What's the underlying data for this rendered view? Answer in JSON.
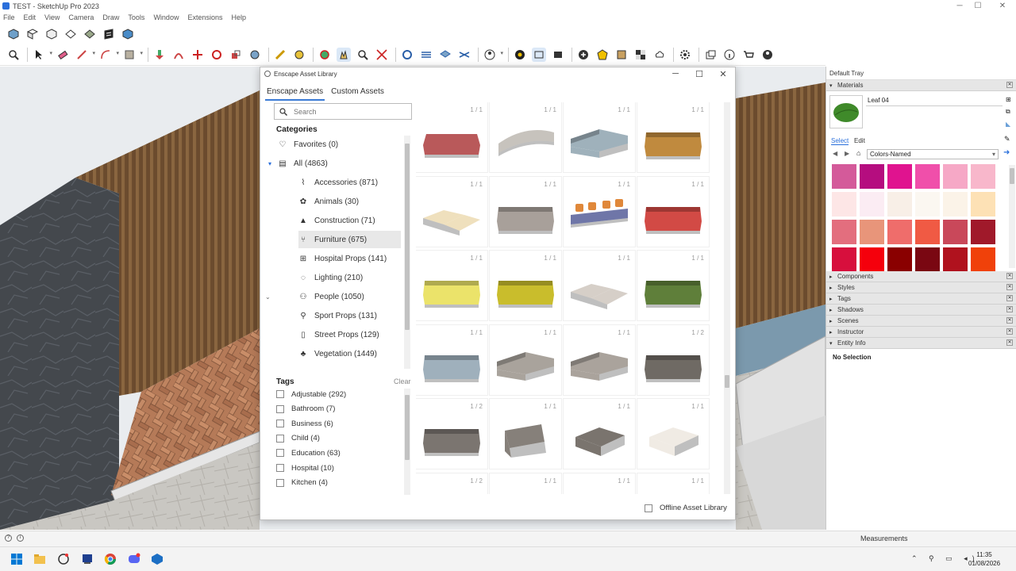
{
  "window": {
    "title": "TEST - SketchUp Pro 2023"
  },
  "menu": [
    "File",
    "Edit",
    "View",
    "Camera",
    "Draw",
    "Tools",
    "Window",
    "Extensions",
    "Help"
  ],
  "dialog": {
    "title": "Enscape Asset Library",
    "tabs": [
      "Enscape Assets",
      "Custom Assets"
    ],
    "search_placeholder": "Search",
    "categories_heading": "Categories",
    "categories": [
      {
        "label": "Favorites (0)",
        "icon": "heart-icon"
      },
      {
        "label": "All (4863)",
        "icon": "library-icon"
      },
      {
        "label": "Accessories (871)",
        "icon": "cup-icon"
      },
      {
        "label": "Animals (30)",
        "icon": "paw-icon"
      },
      {
        "label": "Construction (71)",
        "icon": "cone-icon"
      },
      {
        "label": "Furniture (675)",
        "icon": "chair-icon",
        "selected": true
      },
      {
        "label": "Hospital Props (141)",
        "icon": "hospital-icon"
      },
      {
        "label": "Lighting (210)",
        "icon": "bulb-icon"
      },
      {
        "label": "People (1050)",
        "icon": "people-icon"
      },
      {
        "label": "Sport Props (131)",
        "icon": "sport-icon"
      },
      {
        "label": "Street Props (129)",
        "icon": "street-icon"
      },
      {
        "label": "Vegetation (1449)",
        "icon": "tree-icon"
      }
    ],
    "tags_heading": "Tags",
    "clear_label": "Clear",
    "tags": [
      "Adjustable (292)",
      "Bathroom (7)",
      "Business (6)",
      "Child (4)",
      "Education (63)",
      "Hospital (10)",
      "Kitchen (4)"
    ],
    "assets": [
      {
        "count": "1 / 1",
        "color": "#b9595a",
        "shape": "chester"
      },
      {
        "count": "1 / 1",
        "color": "#c7c3bd",
        "shape": "curve"
      },
      {
        "count": "1 / 1",
        "color": "#9fb1bb",
        "shape": "corner"
      },
      {
        "count": "1 / 1",
        "color": "#c08a3e",
        "shape": "sofa"
      },
      {
        "count": "1 / 1",
        "color": "#efe0bd",
        "shape": "modular"
      },
      {
        "count": "1 / 1",
        "color": "#a8a09a",
        "shape": "sofa"
      },
      {
        "count": "1 / 1",
        "color": "#6f76a8",
        "shape": "bench"
      },
      {
        "count": "1 / 1",
        "color": "#d24a45",
        "shape": "sofa"
      },
      {
        "count": "1 / 1",
        "color": "#ebe36a",
        "shape": "sofa"
      },
      {
        "count": "1 / 1",
        "color": "#c9bd2c",
        "shape": "sofa"
      },
      {
        "count": "1 / 1",
        "color": "#d6cfc8",
        "shape": "modular"
      },
      {
        "count": "1 / 1",
        "color": "#5f7f3a",
        "shape": "sofa"
      },
      {
        "count": "1 / 1",
        "color": "#9fb0bc",
        "shape": "sofa"
      },
      {
        "count": "1 / 1",
        "color": "#a9a39c",
        "shape": "corner"
      },
      {
        "count": "1 / 1",
        "color": "#aaa39c",
        "shape": "corner"
      },
      {
        "count": "1 / 2",
        "color": "#6f6a64",
        "shape": "sofa"
      },
      {
        "count": "1 / 2",
        "color": "#7b7570",
        "shape": "sofa"
      },
      {
        "count": "1 / 1",
        "color": "#86807a",
        "shape": "chair"
      },
      {
        "count": "1 / 1",
        "color": "#7a746e",
        "shape": "ottoman"
      },
      {
        "count": "1 / 1",
        "color": "#f0ebe4",
        "shape": "ottoman"
      },
      {
        "count": "1 / 2",
        "color": "#7a6a5a",
        "shape": "sofa"
      },
      {
        "count": "1 / 1",
        "color": "#8e8a86",
        "shape": "sofa"
      },
      {
        "count": "1 / 1",
        "color": "#cccccc",
        "shape": "sofa"
      },
      {
        "count": "1 / 1",
        "color": "#d62a2a",
        "shape": "sofa"
      }
    ],
    "offline_label": "Offline Asset Library"
  },
  "tray": {
    "title": "Default Tray",
    "materials_label": "Materials",
    "material_name": "Leaf 04",
    "select_tab": "Select",
    "edit_tab": "Edit",
    "library": "Colors-Named",
    "swatches": [
      "#d45a9a",
      "#b50d7f",
      "#e0138f",
      "#f04faa",
      "#f6a8c6",
      "#f8b7cb",
      "#fde6e6",
      "#fbecf3",
      "#f8efe7",
      "#fbf7f1",
      "#fbf3e8",
      "#fde1b5",
      "#e36e7e",
      "#e8957a",
      "#ef6d6b",
      "#f05a44",
      "#c9485a",
      "#a0192a",
      "#d70f3d",
      "#f5000c",
      "#8a0000",
      "#7a0712",
      "#b0121e",
      "#f0410a"
    ],
    "panels": [
      "Components",
      "Styles",
      "Tags",
      "Shadows",
      "Scenes",
      "Instructor",
      "Entity Info"
    ],
    "entity_info": "No Selection"
  },
  "status": {
    "measurements_label": "Measurements"
  },
  "clock": {
    "time": "11:35",
    "date": "01/08/2026"
  },
  "colors": {
    "accent": "#3a7bd5"
  }
}
